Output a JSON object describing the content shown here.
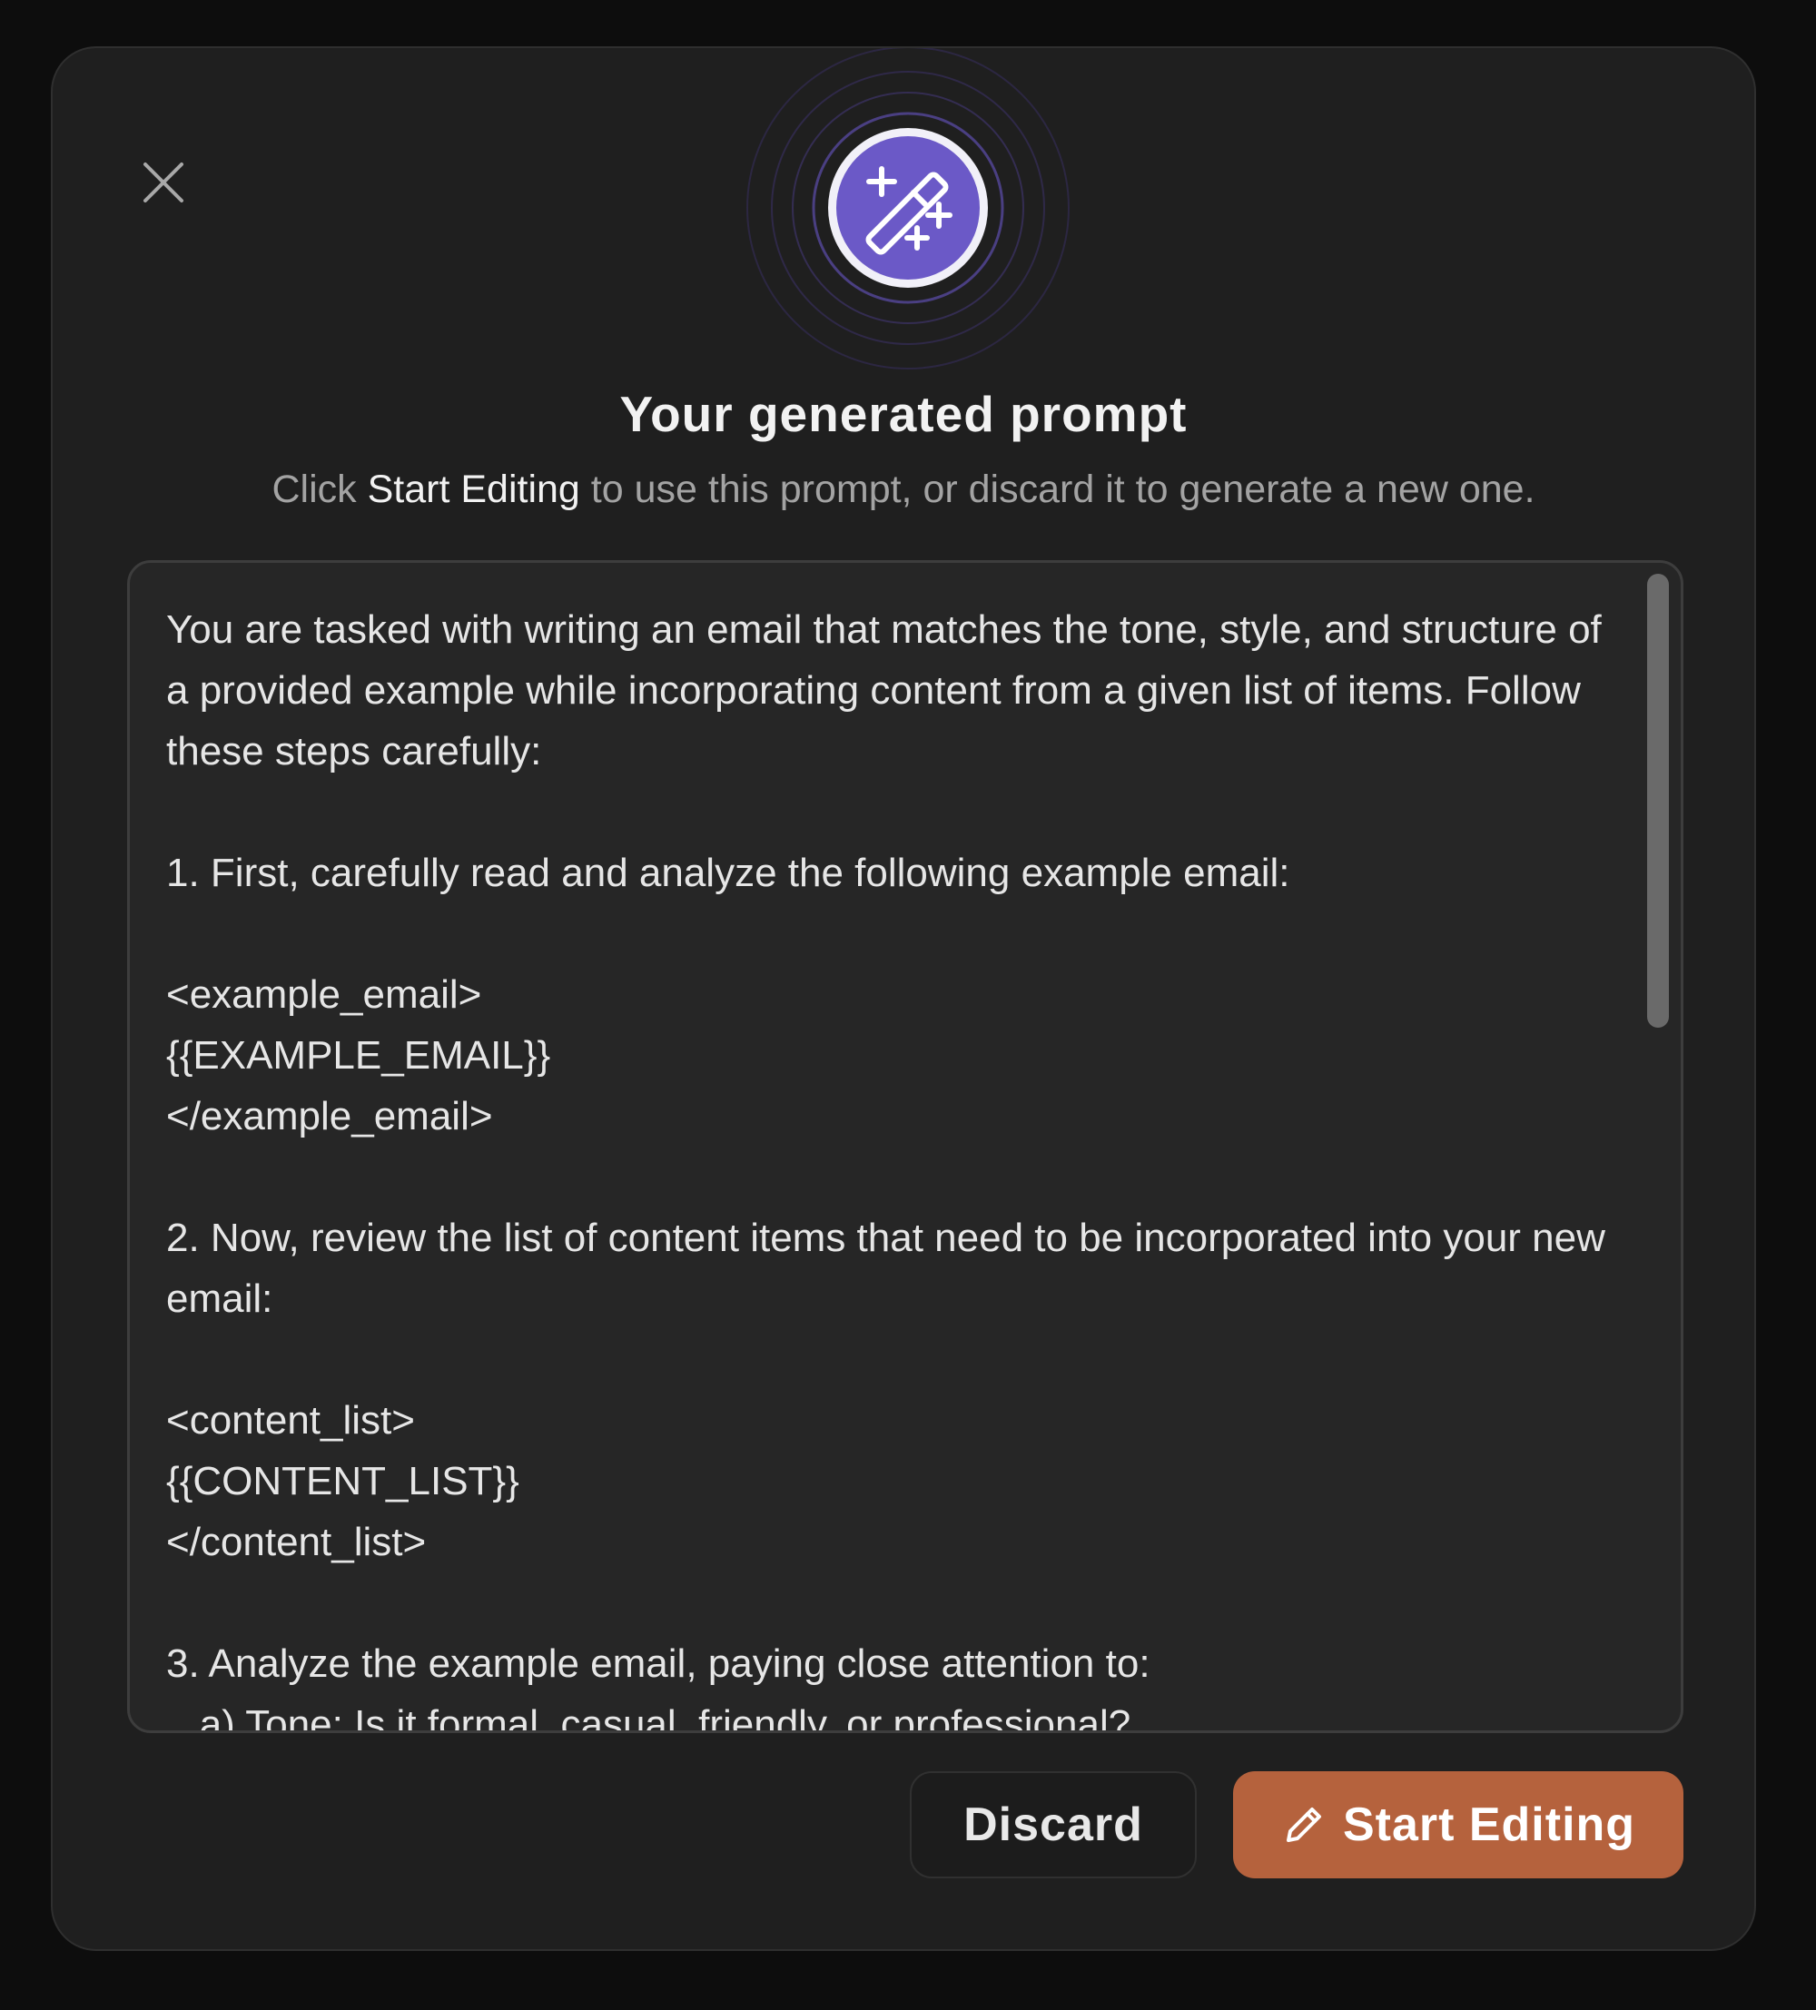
{
  "dialog": {
    "title": "Your generated prompt",
    "subtitle_prefix": "Click",
    "subtitle_emphasis": "Start Editing",
    "subtitle_suffix": "to use this prompt, or discard it to generate a new one.",
    "prompt_text": "You are tasked with writing an email that matches the tone, style, and structure of a provided example while incorporating content from a given list of items. Follow these steps carefully:\n\n1. First, carefully read and analyze the following example email:\n\n<example_email>\n{{EXAMPLE_EMAIL}}\n</example_email>\n\n2. Now, review the list of content items that need to be incorporated into your new email:\n\n<content_list>\n{{CONTENT_LIST}}\n</content_list>\n\n3. Analyze the example email, paying close attention to:\n   a) Tone: Is it formal, casual, friendly, or professional?",
    "scroll_position": 0
  },
  "buttons": {
    "discard_label": "Discard",
    "start_editing_label": "Start Editing"
  },
  "icons": {
    "close": "close-icon",
    "hero": "magic-wand-icon",
    "pencil": "pencil-icon"
  },
  "colors": {
    "background": "#0d0d0d",
    "modal": "#1f1f1f",
    "accent": "#b5623d",
    "icon_purple": "#6b59c7"
  }
}
